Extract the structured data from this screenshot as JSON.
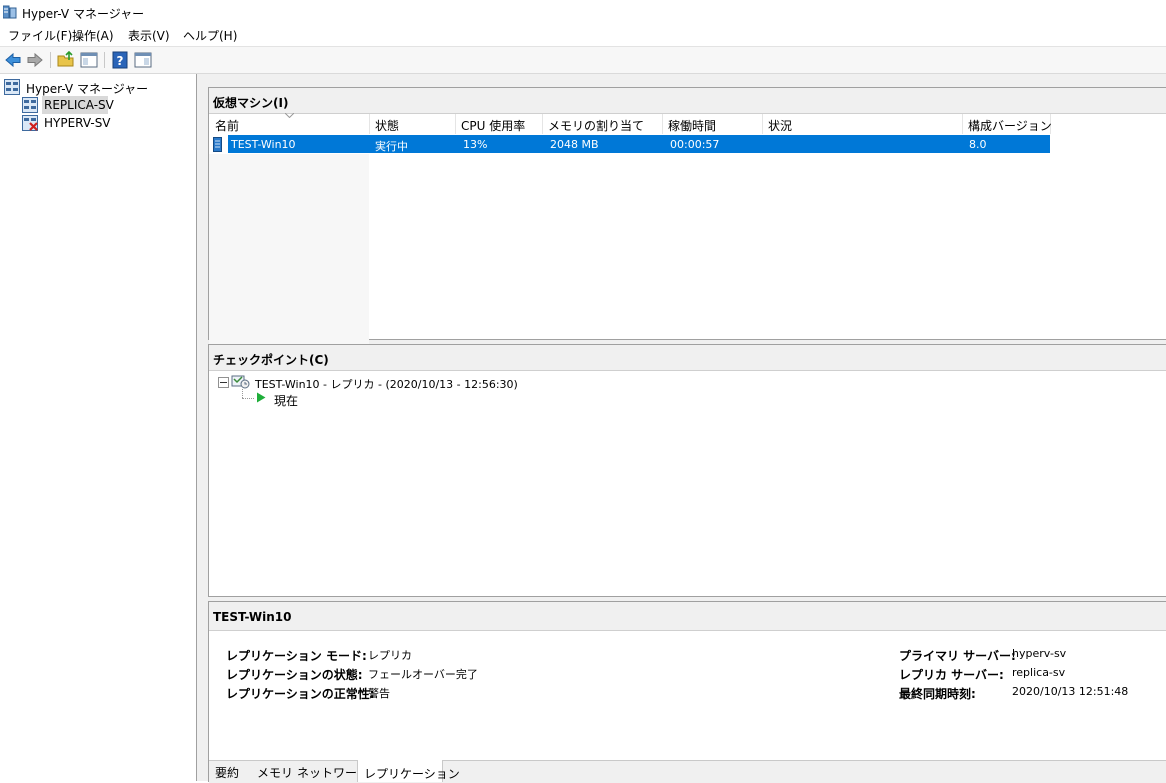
{
  "window": {
    "title": "Hyper-V マネージャー"
  },
  "menu": {
    "items": [
      "ファイル(F)",
      "操作(A)",
      "表示(V)",
      "ヘルプ(H)"
    ]
  },
  "toolbar": {
    "buttons": [
      "back-icon",
      "forward-icon",
      "up-folder-icon",
      "show-hide-tree-icon",
      "help-icon",
      "show-hide-action-pane-icon"
    ]
  },
  "tree": {
    "root": "Hyper-V マネージャー",
    "items": [
      {
        "label": "REPLICA-SV",
        "selected": true
      },
      {
        "label": "HYPERV-SV",
        "selected": false
      }
    ]
  },
  "vm_panel": {
    "title": "仮想マシン(I)",
    "columns": [
      "名前",
      "状態",
      "CPU 使用率",
      "メモリの割り当て",
      "稼働時間",
      "状況",
      "構成バージョン"
    ],
    "rows": [
      {
        "name": "TEST-Win10",
        "state": "実行中",
        "cpu": "13%",
        "memory": "2048 MB",
        "uptime": "00:00:57",
        "status": "",
        "version": "8.0"
      }
    ]
  },
  "checkpoint_panel": {
    "title": "チェックポイント(C)",
    "checkpoint": "TEST-Win10 - レプリカ - (2020/10/13 - 12:56:30)",
    "now": "現在"
  },
  "details_panel": {
    "title": "TEST-Win10",
    "left": [
      {
        "label": "レプリケーション モード:",
        "value": "レプリカ"
      },
      {
        "label": "レプリケーションの状態:",
        "value": "フェールオーバー完了"
      },
      {
        "label": "レプリケーションの正常性:",
        "value": "警告"
      }
    ],
    "right": [
      {
        "label": "プライマリ サーバー:",
        "value": "hyperv-sv"
      },
      {
        "label": "レプリカ サーバー:",
        "value": "replica-sv"
      },
      {
        "label": "最終同期時刻:",
        "value": "2020/10/13 12:51:48"
      }
    ],
    "tabs": [
      "要約",
      "メモリ",
      "ネットワーク",
      "レプリケーション"
    ],
    "active_tab": "レプリケーション"
  },
  "colors": {
    "selection": "#0078d7",
    "panel_bg": "#f0f0f0",
    "tree_selection": "#d9d9d9"
  }
}
